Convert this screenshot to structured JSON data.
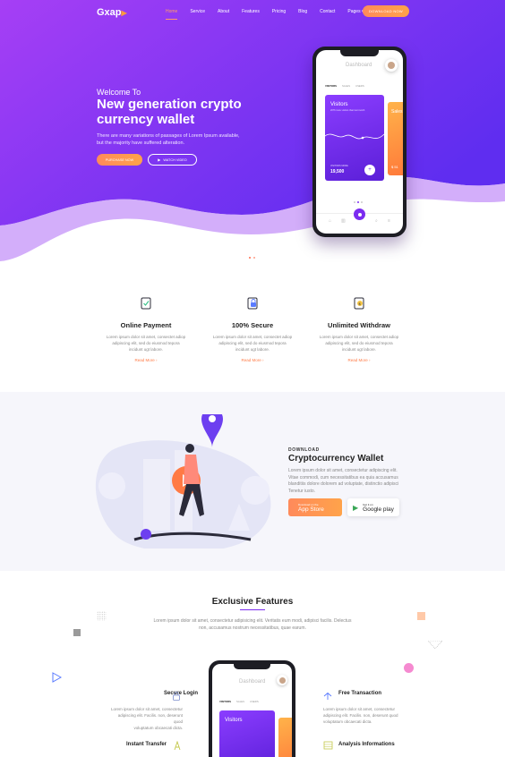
{
  "brand": {
    "name": "Gxap",
    "mark": "▶"
  },
  "nav": {
    "items": [
      "Home",
      "Service",
      "About",
      "Features",
      "Pricing",
      "Blog",
      "Contact",
      "Pages ▾"
    ],
    "download_label": "DOWNLOAD NOW"
  },
  "hero": {
    "welcome": "Welcome To",
    "headline_1": "New generation crypto",
    "headline_2": "currency wallet",
    "desc_1": "There are many variations of passages of Lorem Ipsum available,",
    "desc_2": "but the majority have suffered alteration.",
    "purchase_label": "PURCHASE NOW",
    "watch_label": "WATCH VIDEO"
  },
  "phone": {
    "title": "Dashboard",
    "tabs": [
      "VISITORS",
      "SALES",
      "USERS"
    ],
    "card_title": "Visitors",
    "card_sub": "2076 more visitors than last month",
    "card_value_label": "VISITORS MORE",
    "card_value": "19,500",
    "side_title": "Sales",
    "side_value": "$ 51"
  },
  "features": [
    {
      "title": "Online Payment",
      "text_1": "Lorem ipsum dolor sit amet, consectet adiop",
      "text_2": "adipiscing elit, sed do eiusmod tepora",
      "text_3": "incidunt ugt labore.",
      "link": "Read More"
    },
    {
      "title": "100% Secure",
      "text_1": "Lorem ipsum dolor sit amet, consectet adiop",
      "text_2": "adipiscing elit, sed do eiusmod tepora",
      "text_3": "incidunt ugt labore.",
      "link": "Read More"
    },
    {
      "title": "Unlimited Withdraw",
      "text_1": "Lorem ipsum dolor sit amet, consectet adiop",
      "text_2": "adipiscing elit, sed do eiusmod tepora",
      "text_3": "incidunt ugt labore.",
      "link": "Read More"
    }
  ],
  "download": {
    "eyebrow": "DOWNLOAD",
    "title": "Cryptocurrency Wallet",
    "text_1": "Lorem ipsum dolor sit amet, consectetur adipiscing elit.",
    "text_2": "Vitae commodi, cum necessitatibus ea quia accusamus",
    "text_3": "blanditiis dolore dolorem ad voluptate, distinctio adipisci",
    "text_4": "Tenetur iusto.",
    "appstore_small": "Download on the",
    "appstore_big": "App Store",
    "google_small": "Get it on",
    "google_big": "Google play"
  },
  "exclusive": {
    "title": "Exclusive Features",
    "desc_1": "Lorem ipsum dolor sit amet, consectetur adipisicing elit. Veritatis eum modi, adipisci facilis. Delectus",
    "desc_2": "non, accusamus nostrum necessitatibus, quae earum.",
    "items": [
      {
        "title": "Secure Login",
        "text_1": "Lorem ipsum dolor sit amet, consectetur",
        "text_2": "adipiscing elit. Facilis. non, deserunt quod",
        "text_3": "voluptatum obcaecati dicta."
      },
      {
        "title": "Free Transaction",
        "text_1": "Lorem ipsum dolor sit amet, consectetur",
        "text_2": "adipiscing elit. Facilis. non, deserunt quod",
        "text_3": "voluptatum obcaecati dicta."
      },
      {
        "title": "Instant Transfer"
      },
      {
        "title": "Analysis Informations"
      }
    ],
    "phone_title": "Dashboard",
    "phone_tabs": [
      "VISITORS",
      "SALES",
      "USERS"
    ],
    "phone_card": "Visitors"
  },
  "colors": {
    "accent": "#ff8a5b",
    "purple": "#7b2cf0"
  }
}
